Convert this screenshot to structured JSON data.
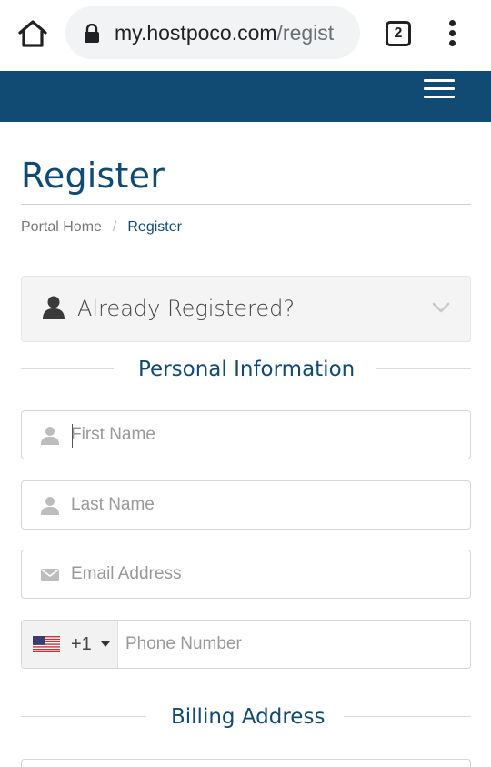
{
  "browser": {
    "url_main": "my.hostpoco.com",
    "url_path": "/regist",
    "tab_count": "2"
  },
  "page": {
    "title": "Register",
    "breadcrumb": {
      "home": "Portal Home",
      "separator": "/",
      "current": "Register"
    }
  },
  "already_registered": {
    "label": "Already Registered?"
  },
  "sections": {
    "personal": "Personal Information",
    "billing": "Billing Address"
  },
  "form": {
    "first_name": {
      "placeholder": "First Name",
      "value": ""
    },
    "last_name": {
      "placeholder": "Last Name",
      "value": ""
    },
    "email": {
      "placeholder": "Email Address",
      "value": ""
    },
    "phone": {
      "country_flag": "us-flag-icon",
      "dial_code": "+1",
      "placeholder": "Phone Number",
      "value": ""
    }
  },
  "colors": {
    "brand": "#114a73",
    "chrome_bg": "#ffffff",
    "url_pill": "#f1f3f4"
  },
  "icons": {
    "home": "home-icon",
    "lock": "lock-icon",
    "tabs": "tab-switcher-icon",
    "menu": "more-vert-icon",
    "hamburger": "hamburger-menu-icon",
    "user": "user-icon",
    "chevron": "chevron-down-icon",
    "email": "envelope-icon"
  }
}
